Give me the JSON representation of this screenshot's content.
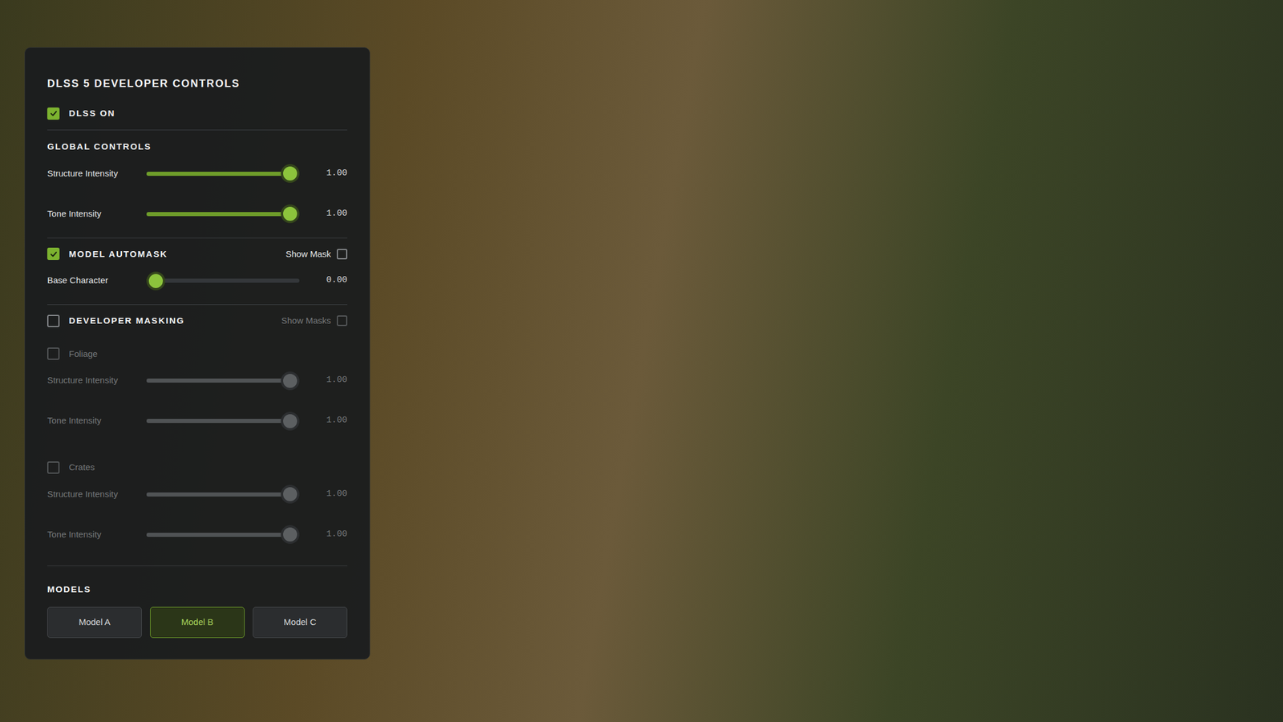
{
  "panel": {
    "title": "DLSS 5 DEVELOPER CONTROLS"
  },
  "dlss": {
    "label": "DLSS ON",
    "checked": true
  },
  "global": {
    "title": "GLOBAL CONTROLS",
    "sliders": [
      {
        "label": "Structure Intensity",
        "level": 1,
        "reading": "1.00",
        "disabled": false
      },
      {
        "label": "Tone Intensity",
        "level": 1,
        "reading": "1.00",
        "disabled": false
      }
    ]
  },
  "automask": {
    "label": "MODEL AUTOMASK",
    "checked": true,
    "show": {
      "label": "Show Mask",
      "checked": false
    },
    "sliders": [
      {
        "label": "Base Character",
        "level": 0,
        "reading": "0.00",
        "disabled": false
      }
    ]
  },
  "developer_masking": {
    "label": "DEVELOPER MASKING",
    "checked": false,
    "show": {
      "label": "Show Masks",
      "checked": false,
      "disabled": true
    },
    "groups": [
      {
        "label": "Foliage",
        "checked": false,
        "disabled": true,
        "sliders": [
          {
            "label": "Structure Intensity",
            "level": 1,
            "reading": "1.00",
            "disabled": true
          },
          {
            "label": "Tone Intensity",
            "level": 1,
            "reading": "1.00",
            "disabled": true
          }
        ]
      },
      {
        "label": "Crates",
        "checked": false,
        "disabled": true,
        "sliders": [
          {
            "label": "Structure Intensity",
            "level": 1,
            "reading": "1.00",
            "disabled": true
          },
          {
            "label": "Tone Intensity",
            "level": 1,
            "reading": "1.00",
            "disabled": true
          }
        ]
      }
    ]
  },
  "models": {
    "title": "MODELS",
    "buttons": [
      {
        "label": "Model A",
        "selected": false
      },
      {
        "label": "Model B",
        "selected": true
      },
      {
        "label": "Model C",
        "selected": false
      }
    ]
  }
}
